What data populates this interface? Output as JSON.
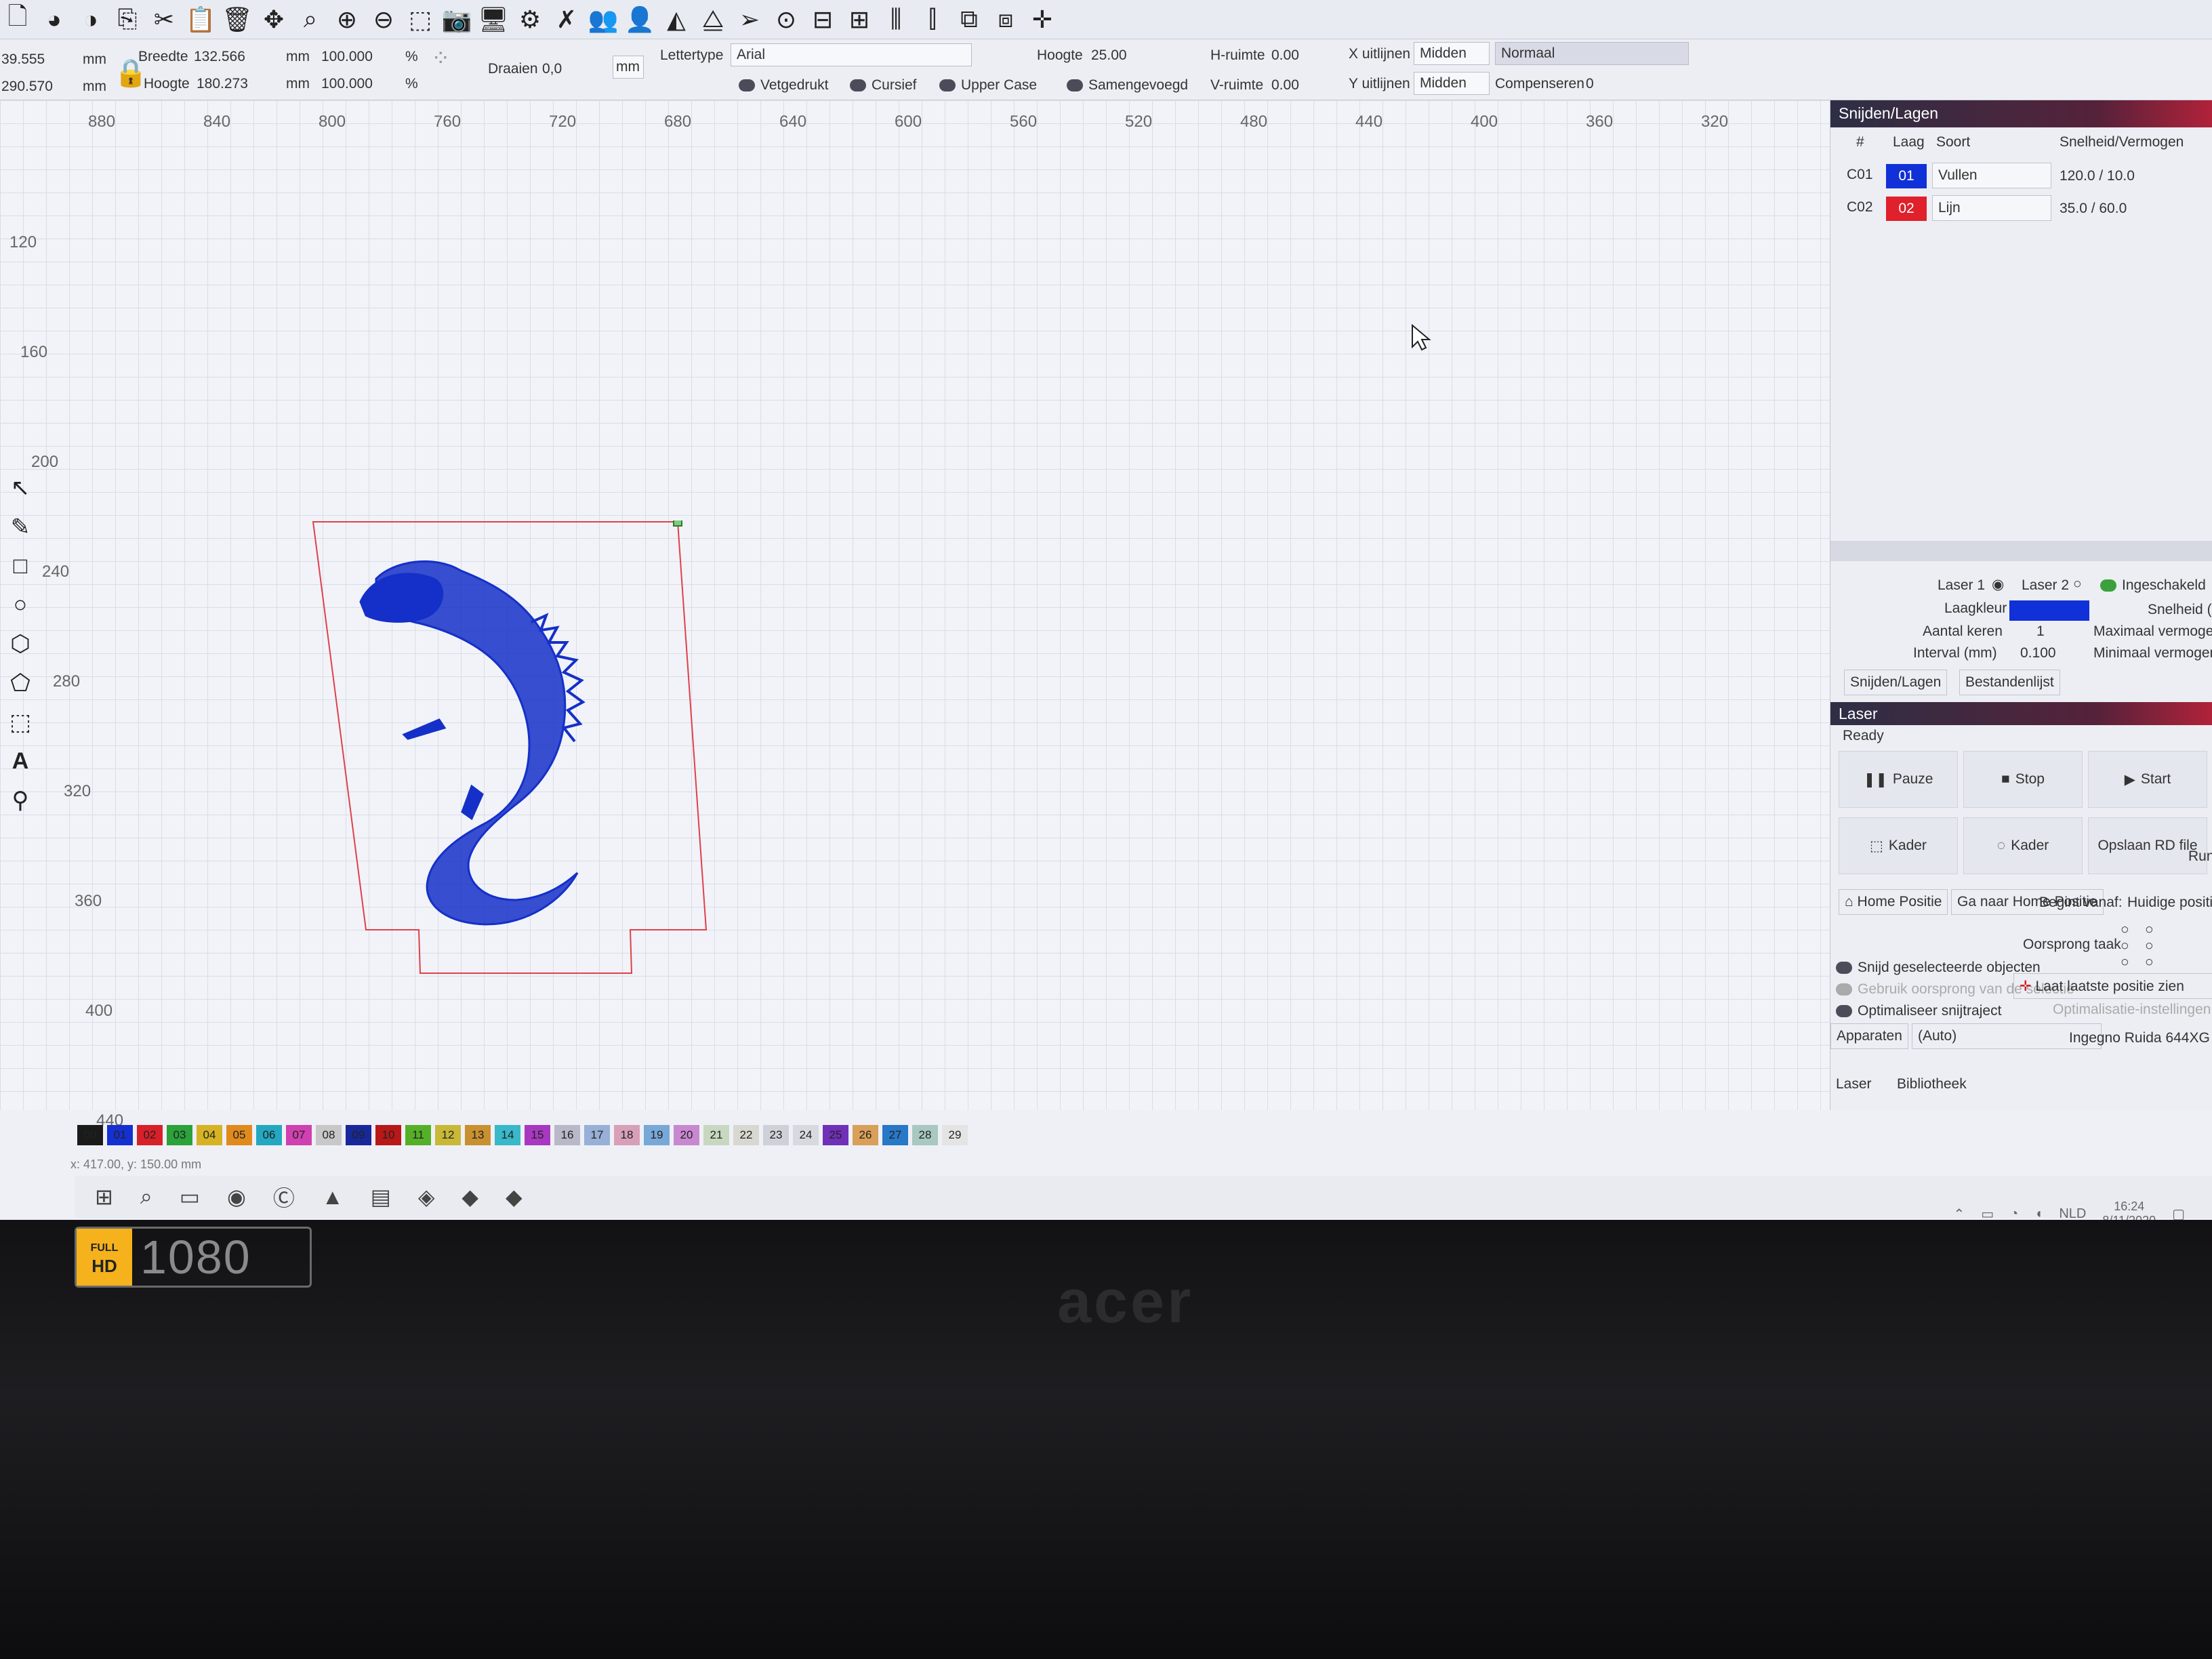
{
  "propbar": {
    "x_value": "39.555",
    "y_value": "290.570",
    "unit_mm": "mm",
    "width_label": "Breedte",
    "width_value": "132.566",
    "height_label": "Hoogte",
    "height_value": "180.273",
    "scale_w": "100.000",
    "scale_h": "100.000",
    "percent": "%",
    "rotate_label": "Draaien",
    "rotate_value": "0,0",
    "mm_button": "mm",
    "font_label": "Lettertype",
    "font_value": "Arial",
    "height2_label": "Hoogte",
    "height2_value": "25.00",
    "hspace_label": "H-ruimte",
    "hspace_value": "0.00",
    "vspace_label": "V-ruimte",
    "vspace_value": "0.00",
    "xalign_label": "X uitlijnen",
    "xalign_value": "Midden",
    "yalign_label": "Y uitlijnen",
    "yalign_value": "Midden",
    "mode_value": "Normaal",
    "compensate_label": "Compenseren",
    "compensate_value": "0",
    "bold_label": "Vetgedrukt",
    "italic_label": "Cursief",
    "upper_label": "Upper Case",
    "joined_label": "Samengevoegd"
  },
  "rulers": {
    "top": [
      "880",
      "840",
      "800",
      "760",
      "720",
      "680",
      "640",
      "600",
      "560",
      "520",
      "480",
      "440",
      "400",
      "360",
      "320"
    ],
    "left": [
      "120",
      "160",
      "200",
      "240",
      "280",
      "320",
      "360",
      "400",
      "440"
    ]
  },
  "panel": {
    "title": "Snijden/Lagen",
    "headers": [
      "#",
      "Laag",
      "Soort",
      "Snelheid/Vermogen"
    ],
    "rows": [
      {
        "id": "C01",
        "layer": "01",
        "color": "#1030d8",
        "type": "Vullen",
        "speed": "120.0 / 10.0"
      },
      {
        "id": "C02",
        "layer": "02",
        "color": "#e0202a",
        "type": "Lijn",
        "speed": "35.0 / 60.0"
      }
    ],
    "laser1": "Laser 1",
    "laser2": "Laser 2",
    "enabled": "Ingeschakeld",
    "layer_color_label": "Laagkleur",
    "speed_label": "Snelheid (m",
    "passes_label": "Aantal keren",
    "passes_value": "1",
    "max_power_label": "Maximaal vermogen",
    "interval_label": "Interval (mm)",
    "interval_value": "0.100",
    "min_power_label": "Minimaal vermogen",
    "tab_cut": "Snijden/Lagen",
    "tab_files": "Bestandenlijst",
    "laser_title": "Laser",
    "status": "Ready",
    "pause": "Pauze",
    "stop": "Stop",
    "start": "Start",
    "frame1": "Kader",
    "frame2": "Kader",
    "save_rd": "Opslaan RD file",
    "run": "Run",
    "home_pos": "Home Positie",
    "go_home": "Ga naar Home Positie",
    "start_from_label": "Begint vanaf:",
    "start_from_value": "Huidige positie",
    "origin_label": "Oorsprong taak",
    "cut_selected": "Snijd geselecteerde objecten",
    "use_origin": "Gebruik oorsprong van de selectie",
    "optimize": "Optimaliseer snijtraject",
    "last_pos": "Laat laatste positie zien",
    "optimize_settings": "Optimalisatie-instellingen",
    "devices_label": "Apparaten",
    "devices_value": "(Auto)",
    "device_name": "Ingegno Ruida 644XG",
    "bottom_tab_laser": "Laser",
    "bottom_tab_library": "Bibliotheek"
  },
  "swatches": [
    {
      "label": "00",
      "color": "#1a1a1a"
    },
    {
      "label": "01",
      "color": "#1530d0"
    },
    {
      "label": "02",
      "color": "#d8202a"
    },
    {
      "label": "03",
      "color": "#2ba23a"
    },
    {
      "label": "04",
      "color": "#d6b324"
    },
    {
      "label": "05",
      "color": "#e08a1e"
    },
    {
      "label": "06",
      "color": "#23a8c0"
    },
    {
      "label": "07",
      "color": "#d040b0"
    },
    {
      "label": "08",
      "color": "#c8c8c8"
    },
    {
      "label": "09",
      "color": "#18289a"
    },
    {
      "label": "10",
      "color": "#b81818"
    },
    {
      "label": "11",
      "color": "#55b028"
    },
    {
      "label": "12",
      "color": "#c8b838"
    },
    {
      "label": "13",
      "color": "#c89030"
    },
    {
      "label": "14",
      "color": "#38b8c8"
    },
    {
      "label": "15",
      "color": "#a838c0"
    },
    {
      "label": "16",
      "color": "#b8b8c8"
    },
    {
      "label": "17",
      "color": "#98b0d8"
    },
    {
      "label": "18",
      "color": "#d8a0b8"
    },
    {
      "label": "19",
      "color": "#78a8d8"
    },
    {
      "label": "20",
      "color": "#c888d0"
    },
    {
      "label": "21",
      "color": "#c8d8c0"
    },
    {
      "label": "22",
      "color": "#d8d8d0"
    },
    {
      "label": "23",
      "color": "#d0d0d8"
    },
    {
      "label": "24",
      "color": "#d8d8e0"
    },
    {
      "label": "25",
      "color": "#7030b8"
    },
    {
      "label": "26",
      "color": "#d8a058"
    },
    {
      "label": "27",
      "color": "#2878c8"
    },
    {
      "label": "28",
      "color": "#a8c8c0"
    },
    {
      "label": "29",
      "color": "#e4e4e4"
    }
  ],
  "status": {
    "coords": "x: 417.00, y: 150.00 mm"
  },
  "tray": {
    "lang": "NLD",
    "time": "16:24",
    "date": "8/11/2020"
  },
  "bezel": {
    "badge_top": "FULL",
    "badge_hd": "HD",
    "badge_res": "1080",
    "brand": "acer"
  },
  "accent": {
    "drawing": "#1530c8",
    "outline": "#e0404a"
  }
}
